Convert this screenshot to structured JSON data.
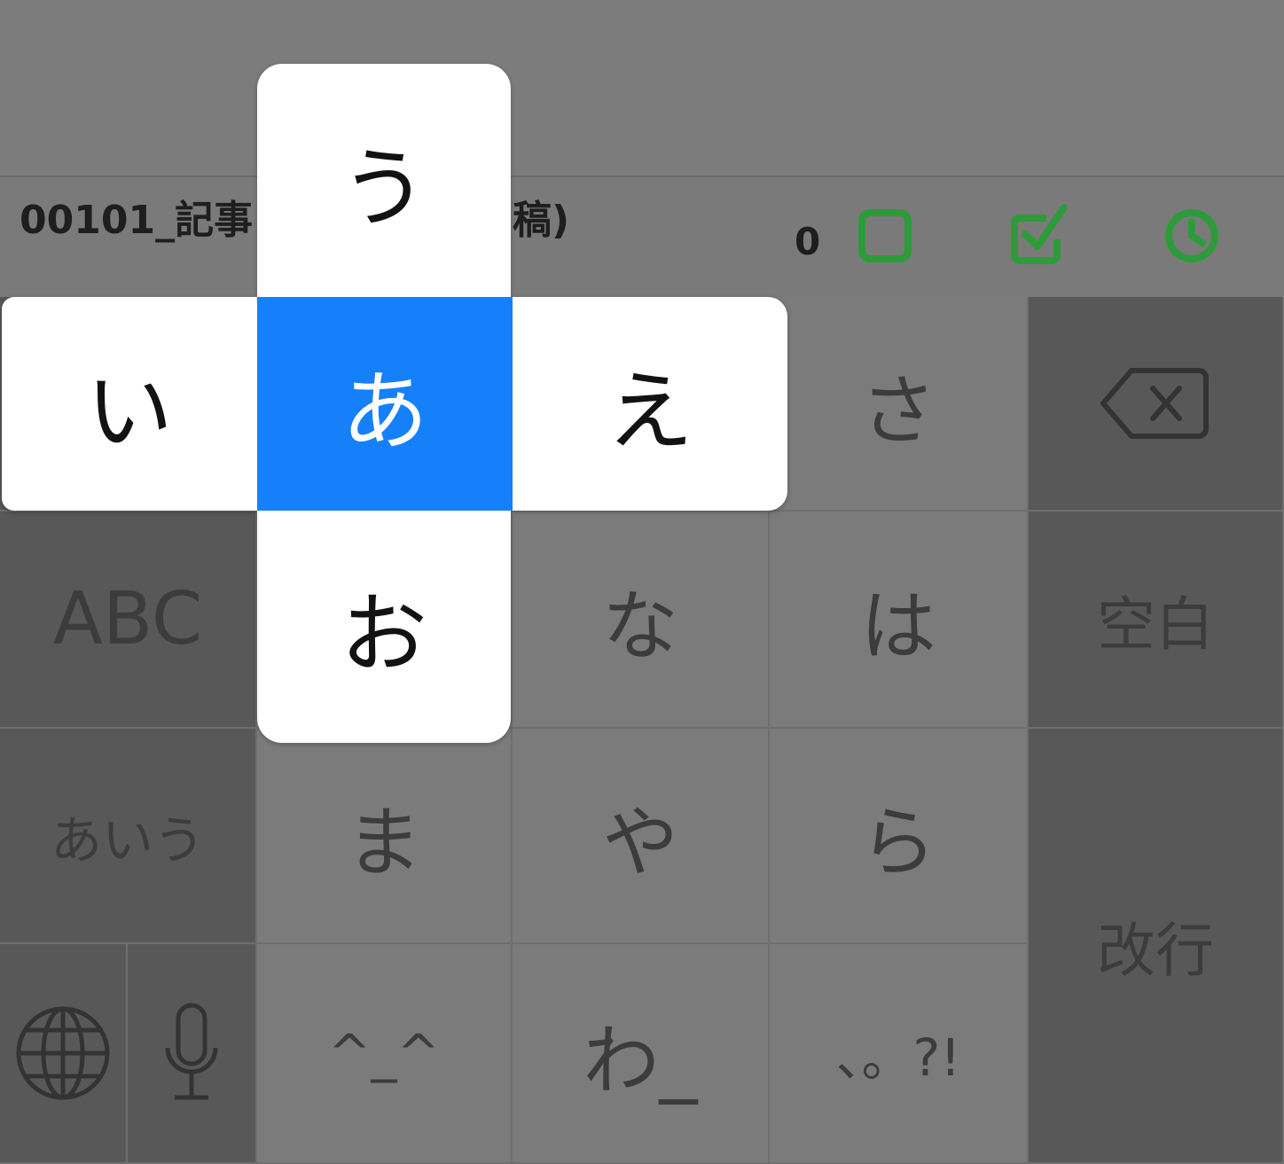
{
  "header": {
    "doc_title_visible": "00101_記事",
    "doc_title_tail": "稿)",
    "count": "0",
    "accent_color": "#2e9b3a",
    "icons": [
      "square-icon",
      "checkbox-checked-icon",
      "clock-icon"
    ]
  },
  "flick": {
    "selected_color": "#1680fa",
    "center": "あ",
    "up": "う",
    "left": "い",
    "right": "え",
    "down": "お"
  },
  "keyboard": {
    "sa": "さ",
    "na": "な",
    "ha": "は",
    "ma": "ま",
    "ya": "や",
    "ra": "ら",
    "wa": "わ_",
    "emoticon": "^_^",
    "punct": "、。?!",
    "abc": "ABC",
    "kana": "あいう",
    "space": "空白",
    "return": "改行",
    "icons": [
      "backspace-icon",
      "globe-icon",
      "microphone-icon"
    ]
  }
}
